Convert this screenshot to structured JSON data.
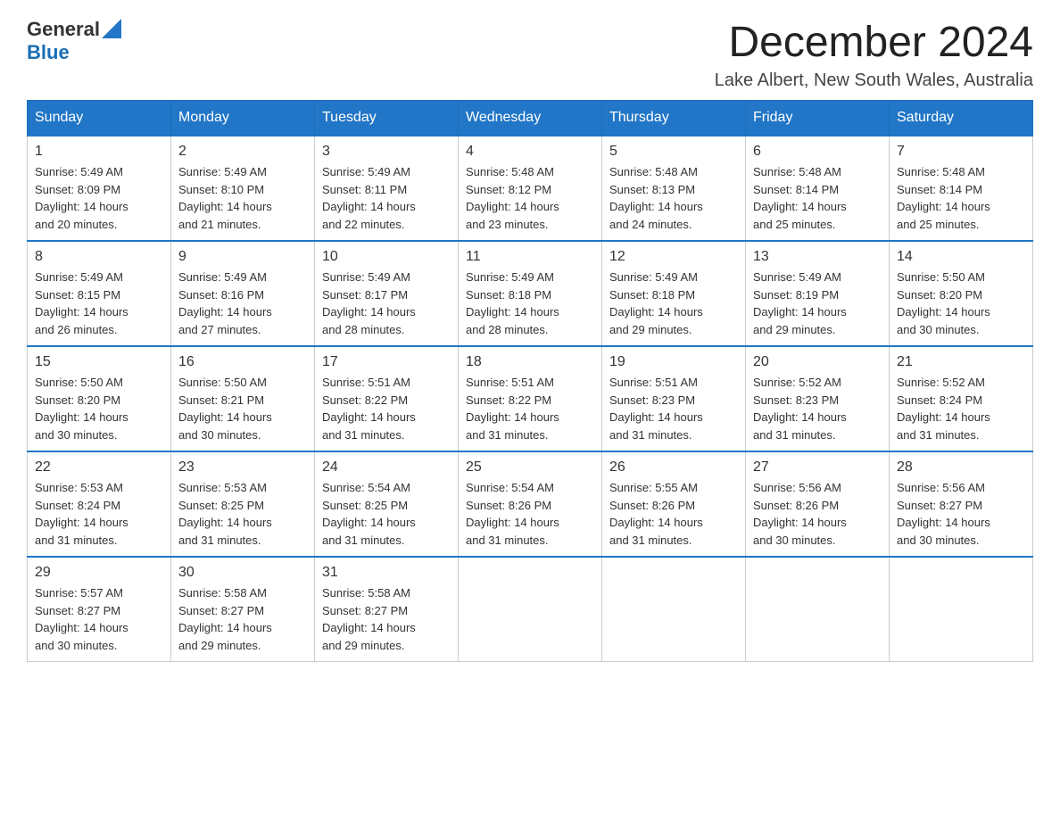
{
  "logo": {
    "general": "General",
    "blue": "Blue"
  },
  "header": {
    "month_year": "December 2024",
    "location": "Lake Albert, New South Wales, Australia"
  },
  "days_of_week": [
    "Sunday",
    "Monday",
    "Tuesday",
    "Wednesday",
    "Thursday",
    "Friday",
    "Saturday"
  ],
  "weeks": [
    [
      {
        "day": "1",
        "sunrise": "5:49 AM",
        "sunset": "8:09 PM",
        "daylight": "14 hours and 20 minutes."
      },
      {
        "day": "2",
        "sunrise": "5:49 AM",
        "sunset": "8:10 PM",
        "daylight": "14 hours and 21 minutes."
      },
      {
        "day": "3",
        "sunrise": "5:49 AM",
        "sunset": "8:11 PM",
        "daylight": "14 hours and 22 minutes."
      },
      {
        "day": "4",
        "sunrise": "5:48 AM",
        "sunset": "8:12 PM",
        "daylight": "14 hours and 23 minutes."
      },
      {
        "day": "5",
        "sunrise": "5:48 AM",
        "sunset": "8:13 PM",
        "daylight": "14 hours and 24 minutes."
      },
      {
        "day": "6",
        "sunrise": "5:48 AM",
        "sunset": "8:14 PM",
        "daylight": "14 hours and 25 minutes."
      },
      {
        "day": "7",
        "sunrise": "5:48 AM",
        "sunset": "8:14 PM",
        "daylight": "14 hours and 25 minutes."
      }
    ],
    [
      {
        "day": "8",
        "sunrise": "5:49 AM",
        "sunset": "8:15 PM",
        "daylight": "14 hours and 26 minutes."
      },
      {
        "day": "9",
        "sunrise": "5:49 AM",
        "sunset": "8:16 PM",
        "daylight": "14 hours and 27 minutes."
      },
      {
        "day": "10",
        "sunrise": "5:49 AM",
        "sunset": "8:17 PM",
        "daylight": "14 hours and 28 minutes."
      },
      {
        "day": "11",
        "sunrise": "5:49 AM",
        "sunset": "8:18 PM",
        "daylight": "14 hours and 28 minutes."
      },
      {
        "day": "12",
        "sunrise": "5:49 AM",
        "sunset": "8:18 PM",
        "daylight": "14 hours and 29 minutes."
      },
      {
        "day": "13",
        "sunrise": "5:49 AM",
        "sunset": "8:19 PM",
        "daylight": "14 hours and 29 minutes."
      },
      {
        "day": "14",
        "sunrise": "5:50 AM",
        "sunset": "8:20 PM",
        "daylight": "14 hours and 30 minutes."
      }
    ],
    [
      {
        "day": "15",
        "sunrise": "5:50 AM",
        "sunset": "8:20 PM",
        "daylight": "14 hours and 30 minutes."
      },
      {
        "day": "16",
        "sunrise": "5:50 AM",
        "sunset": "8:21 PM",
        "daylight": "14 hours and 30 minutes."
      },
      {
        "day": "17",
        "sunrise": "5:51 AM",
        "sunset": "8:22 PM",
        "daylight": "14 hours and 31 minutes."
      },
      {
        "day": "18",
        "sunrise": "5:51 AM",
        "sunset": "8:22 PM",
        "daylight": "14 hours and 31 minutes."
      },
      {
        "day": "19",
        "sunrise": "5:51 AM",
        "sunset": "8:23 PM",
        "daylight": "14 hours and 31 minutes."
      },
      {
        "day": "20",
        "sunrise": "5:52 AM",
        "sunset": "8:23 PM",
        "daylight": "14 hours and 31 minutes."
      },
      {
        "day": "21",
        "sunrise": "5:52 AM",
        "sunset": "8:24 PM",
        "daylight": "14 hours and 31 minutes."
      }
    ],
    [
      {
        "day": "22",
        "sunrise": "5:53 AM",
        "sunset": "8:24 PM",
        "daylight": "14 hours and 31 minutes."
      },
      {
        "day": "23",
        "sunrise": "5:53 AM",
        "sunset": "8:25 PM",
        "daylight": "14 hours and 31 minutes."
      },
      {
        "day": "24",
        "sunrise": "5:54 AM",
        "sunset": "8:25 PM",
        "daylight": "14 hours and 31 minutes."
      },
      {
        "day": "25",
        "sunrise": "5:54 AM",
        "sunset": "8:26 PM",
        "daylight": "14 hours and 31 minutes."
      },
      {
        "day": "26",
        "sunrise": "5:55 AM",
        "sunset": "8:26 PM",
        "daylight": "14 hours and 31 minutes."
      },
      {
        "day": "27",
        "sunrise": "5:56 AM",
        "sunset": "8:26 PM",
        "daylight": "14 hours and 30 minutes."
      },
      {
        "day": "28",
        "sunrise": "5:56 AM",
        "sunset": "8:27 PM",
        "daylight": "14 hours and 30 minutes."
      }
    ],
    [
      {
        "day": "29",
        "sunrise": "5:57 AM",
        "sunset": "8:27 PM",
        "daylight": "14 hours and 30 minutes."
      },
      {
        "day": "30",
        "sunrise": "5:58 AM",
        "sunset": "8:27 PM",
        "daylight": "14 hours and 29 minutes."
      },
      {
        "day": "31",
        "sunrise": "5:58 AM",
        "sunset": "8:27 PM",
        "daylight": "14 hours and 29 minutes."
      },
      null,
      null,
      null,
      null
    ]
  ],
  "labels": {
    "sunrise": "Sunrise:",
    "sunset": "Sunset:",
    "daylight": "Daylight:"
  }
}
